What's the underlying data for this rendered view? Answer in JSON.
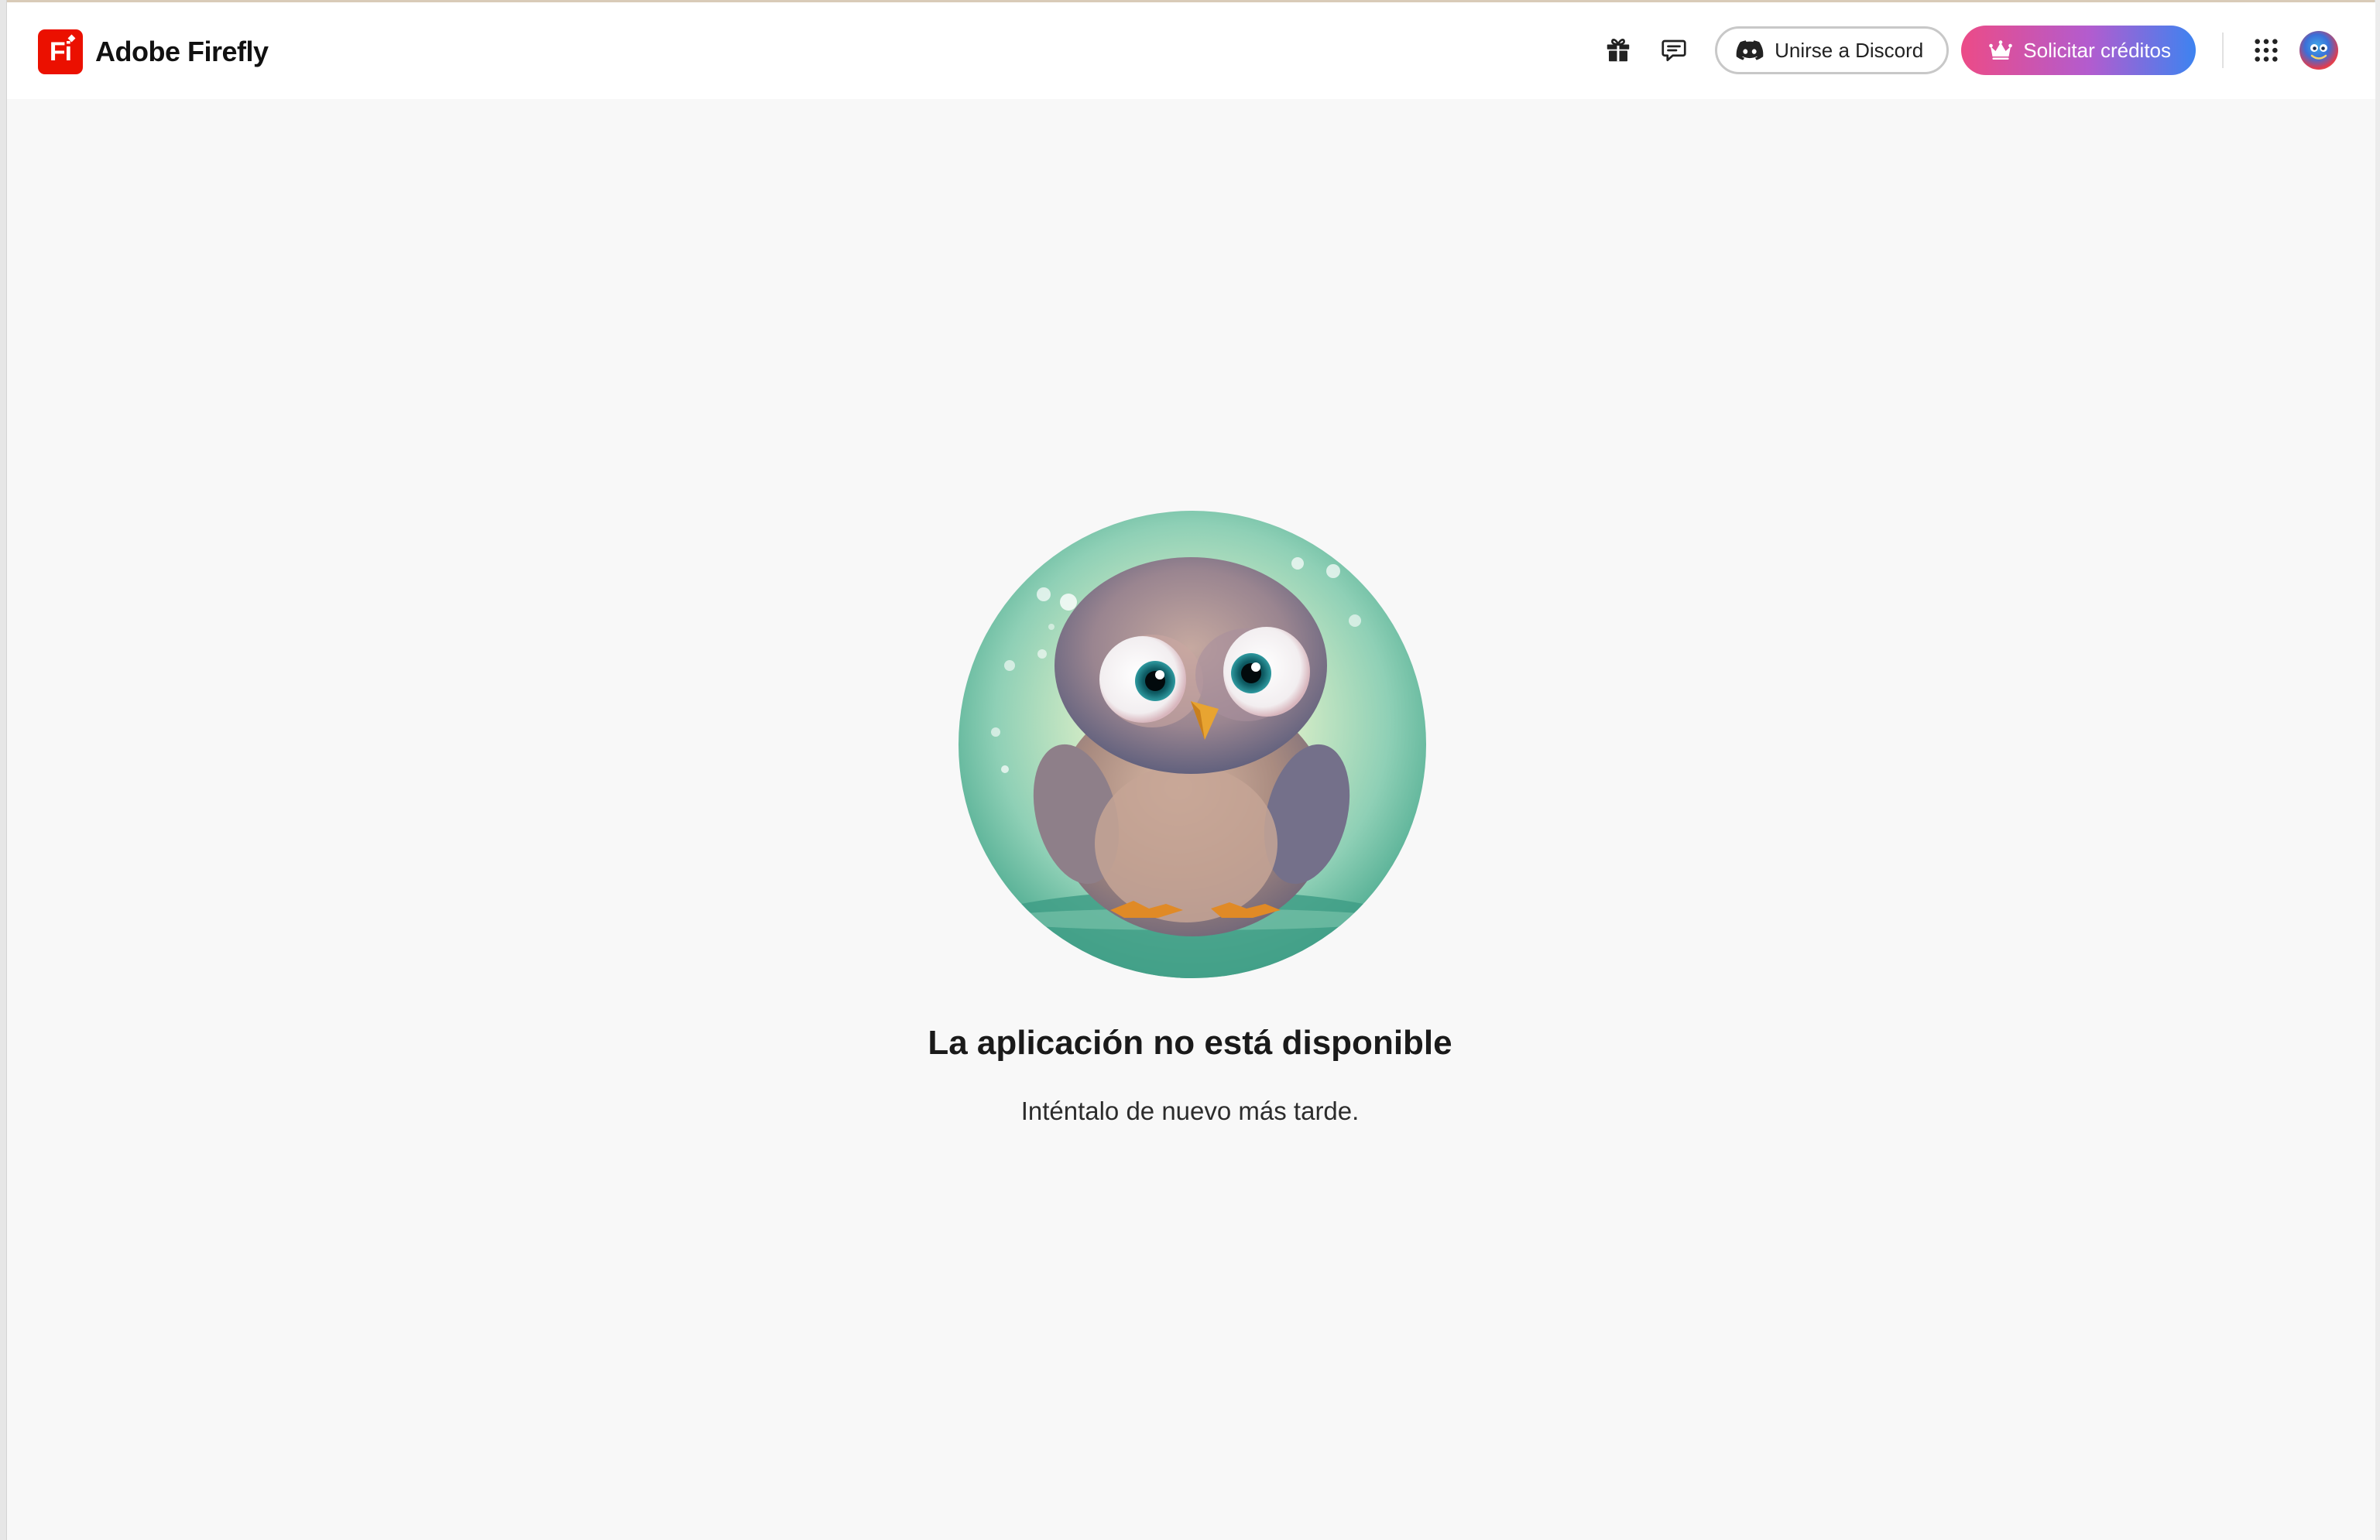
{
  "app": {
    "name": "Adobe Firefly",
    "logo_text": "Fi"
  },
  "header": {
    "discord_button_label": "Unirse a Discord",
    "credits_button_label": "Solicitar créditos",
    "icons": [
      "gift-icon",
      "feedback-icon",
      "discord-icon",
      "crown-icon",
      "apps-grid-icon",
      "avatar"
    ]
  },
  "error": {
    "title": "La aplicación no está disponible",
    "message": "Inténtalo de nuevo más tarde."
  },
  "colors": {
    "brand": "#eb1000",
    "credits_gradient_start": "#ec4b87",
    "credits_gradient_end": "#3d83f0",
    "page_background": "#f8f8f8"
  }
}
